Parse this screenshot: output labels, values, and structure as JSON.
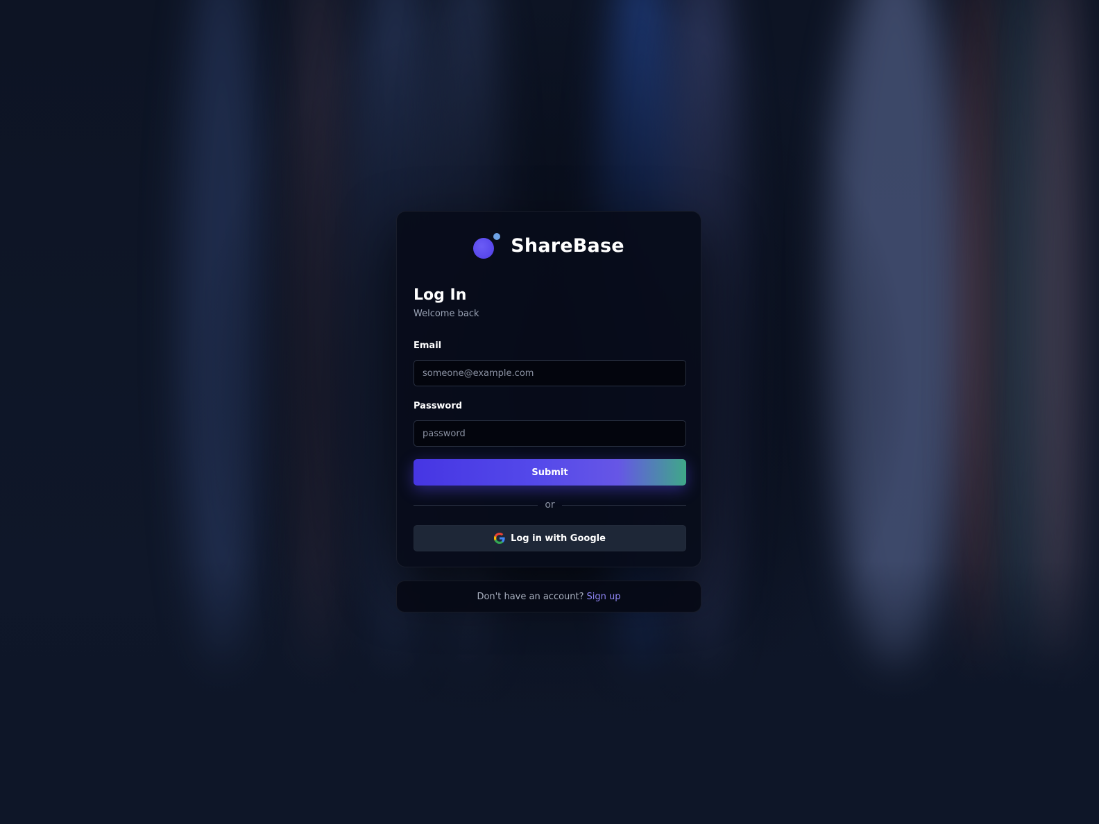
{
  "brand": {
    "name": "ShareBase",
    "logo_icon": "circle-logo-icon",
    "colors": {
      "primary": "#4f3ee6",
      "dot": "#6ea3e6"
    }
  },
  "login": {
    "title": "Log In",
    "subtitle": "Welcome back",
    "email": {
      "label": "Email",
      "placeholder": "someone@example.com",
      "value": ""
    },
    "password": {
      "label": "Password",
      "placeholder": "password",
      "value": ""
    },
    "submit_label": "Submit",
    "divider_text": "or",
    "google": {
      "label": "Log in with Google",
      "icon": "google-icon"
    }
  },
  "signup": {
    "prompt": "Don't have an account?",
    "link_label": "Sign up"
  },
  "theme": {
    "accent": "#5449ea",
    "accent_end": "#3fa888",
    "link": "#8f86f5",
    "background": "#0e1628"
  }
}
